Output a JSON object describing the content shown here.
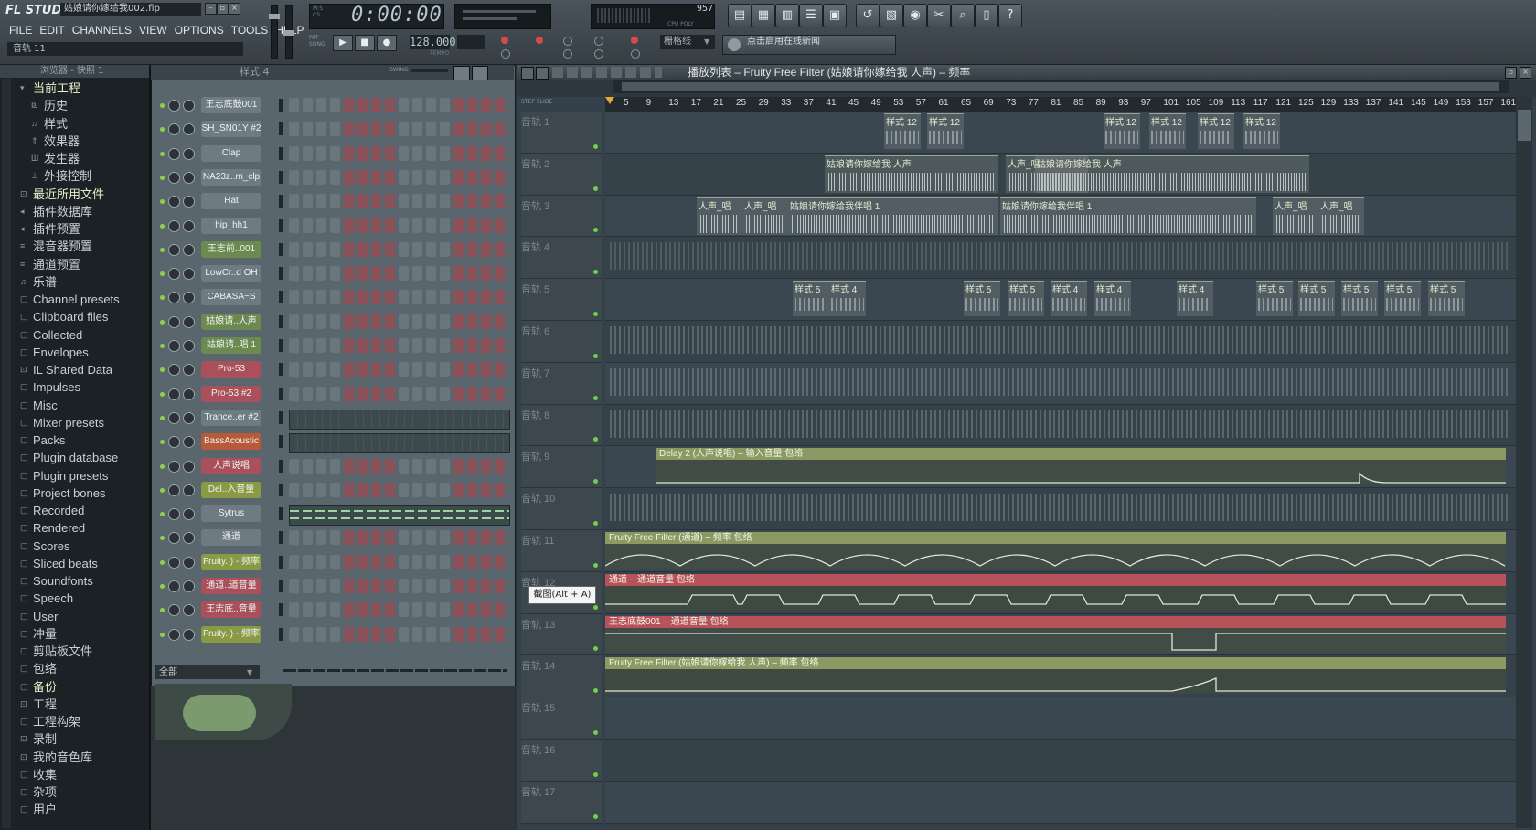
{
  "app": {
    "logo": "FL STUDIO",
    "filename": "姑娘请你嫁给我002.flp",
    "menu": [
      "FILE",
      "EDIT",
      "CHANNELS",
      "VIEW",
      "OPTIONS",
      "TOOLS",
      "HELP"
    ],
    "hint": "音轨 11",
    "time": "0:00:00",
    "tempo": "128.000",
    "tempo_label": "TEMPO",
    "cpu": "957",
    "cpu_label": "CPU  POLY",
    "snap": "栅格线",
    "news": "点击启用在线新闻",
    "tool_icons": [
      "playlist-icon",
      "piano-roll-icon",
      "channel-rack-icon",
      "mixer-icon",
      "browser-icon",
      "undo-icon",
      "save-icon",
      "record-icon",
      "tools-icon",
      "search-icon",
      "file-icon",
      "help-icon"
    ]
  },
  "browser": {
    "title": "浏览器 - 快照 1",
    "items": [
      {
        "label": "当前工程",
        "icon": "▾",
        "level": 0,
        "hl": true
      },
      {
        "label": "历史",
        "icon": "₪",
        "level": 1
      },
      {
        "label": "样式",
        "icon": "♫",
        "level": 1
      },
      {
        "label": "效果器",
        "icon": "⇑",
        "level": 1
      },
      {
        "label": "发生器",
        "icon": "Ш",
        "level": 1
      },
      {
        "label": "外接控制",
        "icon": "⊥",
        "level": 1
      },
      {
        "label": "最近所用文件",
        "icon": "⊡",
        "level": 0,
        "hl": true
      },
      {
        "label": "插件数据库",
        "icon": "◂",
        "level": 0
      },
      {
        "label": "插件预置",
        "icon": "◂",
        "level": 0
      },
      {
        "label": "混音器预置",
        "icon": "≡",
        "level": 0
      },
      {
        "label": "通道预置",
        "icon": "≡",
        "level": 0
      },
      {
        "label": "乐谱",
        "icon": "♫",
        "level": 0
      },
      {
        "label": "Channel presets",
        "icon": "▢",
        "level": 0
      },
      {
        "label": "Clipboard files",
        "icon": "▢",
        "level": 0
      },
      {
        "label": "Collected",
        "icon": "▢",
        "level": 0
      },
      {
        "label": "Envelopes",
        "icon": "▢",
        "level": 0
      },
      {
        "label": "IL Shared Data",
        "icon": "⊡",
        "level": 0
      },
      {
        "label": "Impulses",
        "icon": "▢",
        "level": 0
      },
      {
        "label": "Misc",
        "icon": "▢",
        "level": 0
      },
      {
        "label": "Mixer presets",
        "icon": "▢",
        "level": 0
      },
      {
        "label": "Packs",
        "icon": "▢",
        "level": 0
      },
      {
        "label": "Plugin database",
        "icon": "▢",
        "level": 0
      },
      {
        "label": "Plugin presets",
        "icon": "▢",
        "level": 0
      },
      {
        "label": "Project bones",
        "icon": "▢",
        "level": 0
      },
      {
        "label": "Recorded",
        "icon": "▢",
        "level": 0
      },
      {
        "label": "Rendered",
        "icon": "▢",
        "level": 0
      },
      {
        "label": "Scores",
        "icon": "▢",
        "level": 0
      },
      {
        "label": "Sliced beats",
        "icon": "▢",
        "level": 0
      },
      {
        "label": "Soundfonts",
        "icon": "▢",
        "level": 0
      },
      {
        "label": "Speech",
        "icon": "▢",
        "level": 0
      },
      {
        "label": "User",
        "icon": "▢",
        "level": 0
      },
      {
        "label": "冲量",
        "icon": "▢",
        "level": 0
      },
      {
        "label": "剪贴板文件",
        "icon": "▢",
        "level": 0
      },
      {
        "label": "包络",
        "icon": "▢",
        "level": 0
      },
      {
        "label": "备份",
        "icon": "▢",
        "level": 0,
        "hl": true
      },
      {
        "label": "工程",
        "icon": "⊡",
        "level": 0
      },
      {
        "label": "工程构架",
        "icon": "▢",
        "level": 0
      },
      {
        "label": "录制",
        "icon": "⊡",
        "level": 0
      },
      {
        "label": "我的音色库",
        "icon": "⊡",
        "level": 0
      },
      {
        "label": "收集",
        "icon": "▢",
        "level": 0
      },
      {
        "label": "杂项",
        "icon": "▢",
        "level": 0
      },
      {
        "label": "用户",
        "icon": "▢",
        "level": 0
      }
    ]
  },
  "rack": {
    "title": "样式 4",
    "swing_label": "SWING",
    "footer": "全部",
    "channels": [
      {
        "name": "王志底鼓001",
        "color": "#6f7b82",
        "type": "steps"
      },
      {
        "name": "SH_SN01Y #2",
        "color": "#6f7b82",
        "type": "steps"
      },
      {
        "name": "Clap",
        "color": "#6f7b82",
        "type": "steps"
      },
      {
        "name": "NA23z..m_clp",
        "color": "#6f7b82",
        "type": "steps"
      },
      {
        "name": "Hat",
        "color": "#6f7b82",
        "type": "steps"
      },
      {
        "name": "hip_hh1",
        "color": "#6f7b82",
        "type": "steps"
      },
      {
        "name": "王志前..001",
        "color": "#6c8a4f",
        "type": "steps"
      },
      {
        "name": "LowCr..d OH",
        "color": "#6f7b82",
        "type": "steps"
      },
      {
        "name": "CABASA~S",
        "color": "#6f7b82",
        "type": "steps"
      },
      {
        "name": "姑娘请..人声",
        "color": "#6c8a4f",
        "type": "steps"
      },
      {
        "name": "姑娘请..唱 1",
        "color": "#6c8a4f",
        "type": "steps"
      },
      {
        "name": "Pro-53",
        "color": "#a9505a",
        "type": "steps"
      },
      {
        "name": "Pro-53 #2",
        "color": "#a9505a",
        "type": "steps"
      },
      {
        "name": "Trance..er #2",
        "color": "#6f7b82",
        "type": "roll"
      },
      {
        "name": "BassAcoustic",
        "color": "#b65a3a",
        "type": "roll"
      },
      {
        "name": "人声说唱",
        "color": "#a9505a",
        "type": "steps"
      },
      {
        "name": "Del..入音量",
        "color": "#8a9a44",
        "type": "steps"
      },
      {
        "name": "Sytrus",
        "color": "#6f7b82",
        "type": "roll"
      },
      {
        "name": "通道",
        "color": "#6f7b82",
        "type": "steps"
      },
      {
        "name": "Fruity..) - 频率",
        "color": "#8a9a44",
        "type": "steps"
      },
      {
        "name": "通道..道音量",
        "color": "#a9505a",
        "type": "steps"
      },
      {
        "name": "王志底..音量",
        "color": "#a9505a",
        "type": "steps"
      },
      {
        "name": "Fruity..) - 频率",
        "color": "#8a9a44",
        "type": "steps"
      }
    ]
  },
  "playlist": {
    "title": "播放列表 – Fruity Free Filter (姑娘请你嫁给我 人声) – 频率",
    "ruler_label": "STEP  SLIDE",
    "bars": [
      "5",
      "9",
      "13",
      "17",
      "21",
      "25",
      "29",
      "33",
      "37",
      "41",
      "45",
      "49",
      "53",
      "57",
      "61",
      "65",
      "69",
      "73",
      "77",
      "81",
      "85",
      "89",
      "93",
      "97",
      "101",
      "105",
      "109",
      "113",
      "117",
      "121",
      "125",
      "129",
      "133",
      "137",
      "141",
      "145",
      "149",
      "153",
      "157",
      "161"
    ],
    "tooltip": "截图(Alt + A)",
    "tracks": [
      {
        "name": "音轨 1",
        "clips": [
          "样式 12",
          "样式 12",
          "样式 12",
          "样式 12",
          "样式 12",
          "样式 12"
        ]
      },
      {
        "name": "音轨 2",
        "clips": [
          "姑娘请你嫁给我 人声",
          "人声_唱",
          "姑娘请你嫁给我 人声"
        ]
      },
      {
        "name": "音轨 3",
        "clips": [
          "人声_唱",
          "人声_唱",
          "姑娘请你嫁给我伴唱 1",
          "姑娘请你嫁给我伴唱 1",
          "人声_唱",
          "人声_唱"
        ]
      },
      {
        "name": "音轨 4",
        "clips": []
      },
      {
        "name": "音轨 5",
        "clips": [
          "样式 5",
          "样式 4",
          "样式 5",
          "样式 5",
          "样式 4",
          "样式 4",
          "样式 4",
          "样式 5",
          "样式 5",
          "样式 5",
          "样式 5",
          "样式 5"
        ]
      },
      {
        "name": "音轨 6",
        "clips": []
      },
      {
        "name": "音轨 7",
        "clips": []
      },
      {
        "name": "音轨 8",
        "clips": []
      },
      {
        "name": "音轨 9",
        "clips": [
          "Delay 2 (人声说唱) – 输入音量 包络"
        ]
      },
      {
        "name": "音轨 10",
        "clips": []
      },
      {
        "name": "音轨 11",
        "clips": [
          "Fruity Free Filter (通道) – 频率 包络"
        ]
      },
      {
        "name": "音轨 12",
        "clips": [
          "通道 – 通道音量 包络"
        ]
      },
      {
        "name": "音轨 13",
        "clips": [
          "王志底鼓001 – 通道音量 包络"
        ]
      },
      {
        "name": "音轨 14",
        "clips": [
          "Fruity Free Filter (姑娘请你嫁给我 人声) – 频率 包络"
        ]
      },
      {
        "name": "音轨 15",
        "clips": []
      },
      {
        "name": "音轨 16",
        "clips": []
      },
      {
        "name": "音轨 17",
        "clips": []
      }
    ]
  }
}
